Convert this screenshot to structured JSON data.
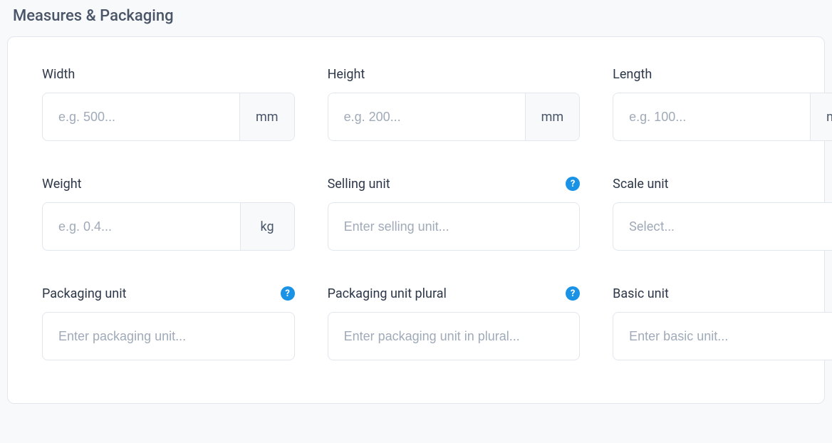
{
  "section": {
    "title": "Measures & Packaging"
  },
  "fields": {
    "width": {
      "label": "Width",
      "placeholder": "e.g. 500...",
      "suffix": "mm"
    },
    "height": {
      "label": "Height",
      "placeholder": "e.g. 200...",
      "suffix": "mm"
    },
    "length": {
      "label": "Length",
      "placeholder": "e.g. 100...",
      "suffix": "mm"
    },
    "weight": {
      "label": "Weight",
      "placeholder": "e.g. 0.4...",
      "suffix": "kg"
    },
    "selling_unit": {
      "label": "Selling unit",
      "placeholder": "Enter selling unit...",
      "help": "?"
    },
    "scale_unit": {
      "label": "Scale unit",
      "placeholder": "Select..."
    },
    "packaging_unit": {
      "label": "Packaging unit",
      "placeholder": "Enter packaging unit...",
      "help": "?"
    },
    "packaging_unit_plural": {
      "label": "Packaging unit plural",
      "placeholder": "Enter packaging unit in plural...",
      "help": "?"
    },
    "basic_unit": {
      "label": "Basic unit",
      "placeholder": "Enter basic unit...",
      "help": "?"
    }
  }
}
